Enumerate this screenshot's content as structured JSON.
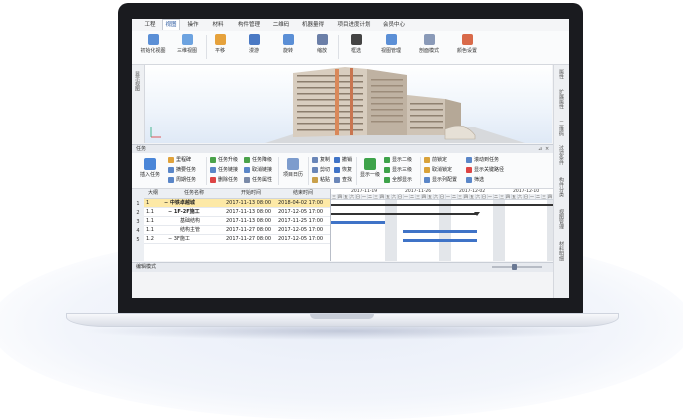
{
  "menu_tabs": [
    {
      "label": "工程",
      "active": false
    },
    {
      "label": "视图",
      "active": true
    },
    {
      "label": "操作",
      "active": false
    },
    {
      "label": "材料",
      "active": false
    },
    {
      "label": "构件管理",
      "active": false
    },
    {
      "label": "二维码",
      "active": false
    },
    {
      "label": "机器量得",
      "active": false
    },
    {
      "label": "项目进度计划",
      "active": false
    },
    {
      "label": "会员中心",
      "active": false
    }
  ],
  "ribbon": [
    {
      "label": "初始化视图",
      "icon": "home-view-icon",
      "color": "#5b8fd6"
    },
    {
      "label": "三维视图",
      "icon": "cube-icon",
      "color": "#6da3e0"
    },
    {
      "label": "平移",
      "icon": "move-icon",
      "color": "#e6a23c"
    },
    {
      "label": "漫游",
      "icon": "walk-icon",
      "color": "#4a79c4"
    },
    {
      "label": "旋转",
      "icon": "rotate-icon",
      "color": "#5b8fd6"
    },
    {
      "label": "缩放",
      "icon": "zoom-icon",
      "color": "#6b7fa8"
    },
    {
      "label": "框选",
      "icon": "box-select-icon",
      "color": "#444444"
    },
    {
      "label": "视图管理",
      "icon": "view-manage-icon",
      "color": "#5b8fd6"
    },
    {
      "label": "剖面模式",
      "icon": "section-icon",
      "color": "#8a9ab8"
    },
    {
      "label": "颜色设置",
      "icon": "color-settings-icon",
      "color": "#d96a4a"
    }
  ],
  "left_panel_label": "显示视图",
  "right_side_tabs": [
    "属性",
    "扩展属性",
    "二维码",
    "过滤条件",
    "构件分类",
    "视图管理",
    "材料明细"
  ],
  "task_panel": {
    "title": "任务",
    "insert_task": "插入任务",
    "timeline_view": "项目日历",
    "display_level": "显示一级",
    "groups": [
      [
        "里程碑",
        "摘要任务",
        "周期任务"
      ],
      [
        "任务升级",
        "任务链接",
        "删除任务"
      ],
      [
        "任务降级",
        "取消链接",
        "任务属性"
      ],
      [
        "复制",
        "剪切",
        "粘贴"
      ],
      [
        "撤销",
        "恢复",
        "查找"
      ],
      [
        "显示二级",
        "显示三级",
        "全部显示"
      ],
      [
        "前锁定",
        "取消锁定",
        "显示列配置"
      ],
      [
        "滚动到任务",
        "显示关键路径",
        "筛选"
      ]
    ]
  },
  "table": {
    "columns": [
      "大纲",
      "任务名称",
      "开始时间",
      "结束时间"
    ],
    "rows": [
      {
        "num": "1",
        "outline": "1",
        "name": "− 中铁卓越城",
        "start": "2017-11-13 08:00",
        "end": "2018-04-02 17:00",
        "selected": true
      },
      {
        "num": "2",
        "outline": "1.1",
        "name": "− 1F-2F施工",
        "start": "2017-11-13 08:00",
        "end": "2017-12-05 17:00",
        "selected": false
      },
      {
        "num": "3",
        "outline": "1.1",
        "name": "基础结构",
        "start": "2017-11-13 08:00",
        "end": "2017-11-25 17:00",
        "selected": false
      },
      {
        "num": "4",
        "outline": "1.1",
        "name": "结构主管",
        "start": "2017-11-27 08:00",
        "end": "2017-12-05 17:00",
        "selected": false
      },
      {
        "num": "5",
        "outline": "1.2",
        "name": "− 3F施工",
        "start": "2017-11-27 08:00",
        "end": "2017-12-05 17:00",
        "selected": false
      }
    ]
  },
  "gantt": {
    "weeks": [
      "2017-11-19",
      "2017-11-26",
      "2017-12-02",
      "2017-12-10"
    ],
    "day_labels": [
      "三",
      "四",
      "五",
      "六",
      "日",
      "一",
      "二"
    ]
  },
  "status_bar": {
    "mode": "编辑模式"
  },
  "colors": {
    "accent": "#1d4f9a",
    "gantt_bar": "#3f73c7",
    "selected_row": "#fde9a6"
  }
}
